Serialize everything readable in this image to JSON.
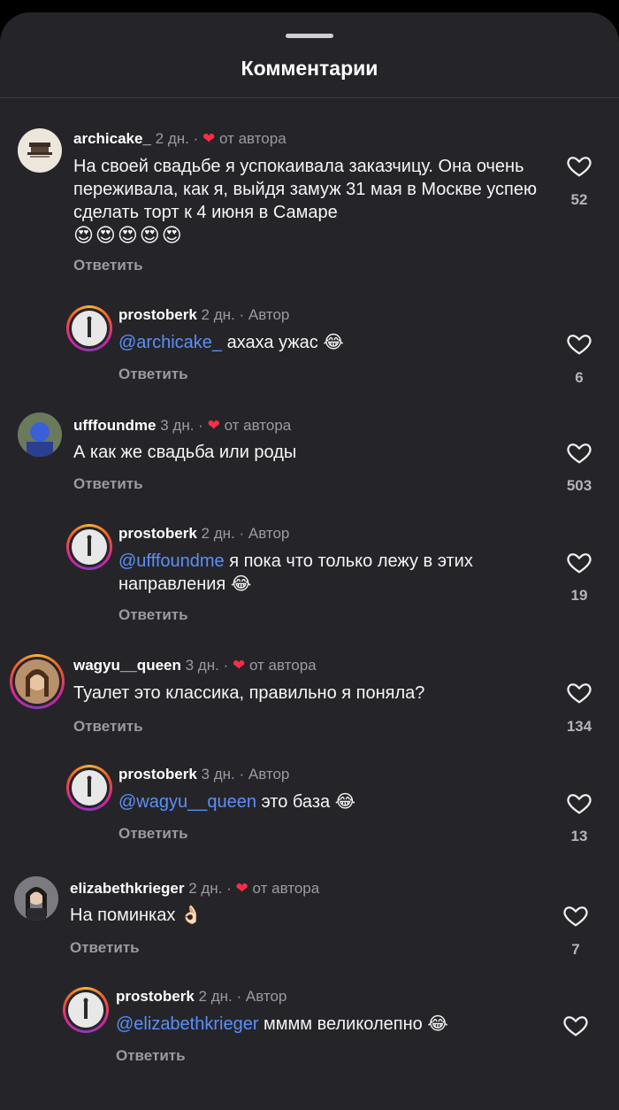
{
  "header": {
    "title": "Комментарии"
  },
  "colors": {
    "mention": "#5b8ff9",
    "heart": "#ff2d48",
    "background": "#252529"
  },
  "comments": [
    {
      "user": "archicake_",
      "time": "2 дн.",
      "sep": "·",
      "badge": "от автора",
      "text": "На своей свадьбе я успокаивала заказчицу. Она очень переживала, как я, выйдя замуж 31 мая в Москве успею сделать торт к 4 июня в Самаре",
      "emoji": "😍😍😍😍😍",
      "reply_label": "Ответить",
      "likes": "52"
    },
    {
      "user": "prostoberk",
      "time": "2 дн.",
      "sep": "·",
      "badge": "Автор",
      "mention": "@archicake_",
      "text": " ахаха ужас ",
      "emoji": "😂",
      "reply_label": "Ответить",
      "likes": "6"
    },
    {
      "user": "ufffoundme",
      "time": "3 дн.",
      "sep": "·",
      "badge": "от автора",
      "text": "А как же свадьба или роды",
      "reply_label": "Ответить",
      "likes": "503"
    },
    {
      "user": "prostoberk",
      "time": "2 дн.",
      "sep": "·",
      "badge": "Автор",
      "mention": "@ufffoundme",
      "text": " я пока что только лежу в этих направления ",
      "emoji": "😂",
      "reply_label": "Ответить",
      "likes": "19"
    },
    {
      "user": "wagyu__queen",
      "time": "3 дн.",
      "sep": "·",
      "badge": "от автора",
      "text": "Туалет это классика, правильно я поняла?",
      "reply_label": "Ответить",
      "likes": "134"
    },
    {
      "user": "prostoberk",
      "time": "3 дн.",
      "sep": "·",
      "badge": "Автор",
      "mention": "@wagyu__queen",
      "text": " это база ",
      "emoji": "😂",
      "reply_label": "Ответить",
      "likes": "13"
    },
    {
      "user": "elizabethkrieger",
      "time": "2 дн.",
      "sep": "·",
      "badge": "от автора",
      "text": "На поминках ",
      "emoji": "👌🏻",
      "reply_label": "Ответить",
      "likes": "7"
    },
    {
      "user": "prostoberk",
      "time": "2 дн.",
      "sep": "·",
      "badge": "Автор",
      "mention": "@elizabethkrieger",
      "text": " мммм великолепно ",
      "emoji": "😂",
      "reply_label": "Ответить"
    }
  ],
  "icons": {
    "like": "heart-outline-icon",
    "author_like": "heart-filled-icon"
  }
}
